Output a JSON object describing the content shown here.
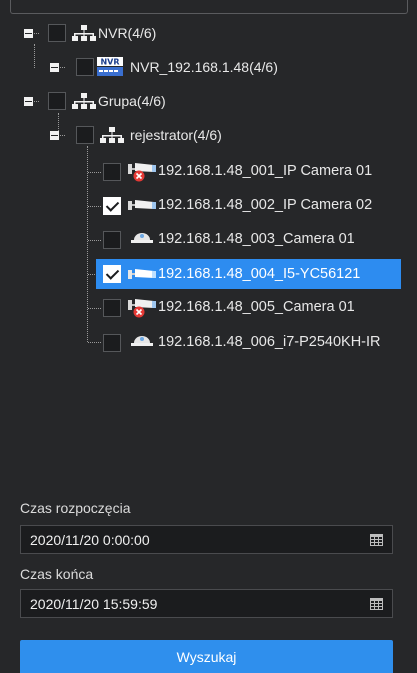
{
  "tree": {
    "nvr_group": "NVR(4/6)",
    "nvr_device": "NVR_192.168.1.48(4/6)",
    "nvr_badge": "NVR",
    "grupa": "Grupa(4/6)",
    "rejestrator": "rejestrator(4/6)",
    "cameras": [
      {
        "label": "192.168.1.48_001_IP Camera 01",
        "checked": false,
        "offline": true
      },
      {
        "label": "192.168.1.48_002_IP Camera 02",
        "checked": true,
        "offline": false
      },
      {
        "label": "192.168.1.48_003_Camera 01",
        "checked": false,
        "offline": false
      },
      {
        "label": "192.168.1.48_004_I5-YC56121",
        "checked": true,
        "offline": false
      },
      {
        "label": "192.168.1.48_005_Camera 01",
        "checked": false,
        "offline": true
      },
      {
        "label": "192.168.1.48_006_i7-P2540KH-IR",
        "checked": false,
        "offline": false
      }
    ]
  },
  "form": {
    "start_label": "Czas rozpoczęcia",
    "start_value": "2020/11/20 0:00:00",
    "end_label": "Czas końca",
    "end_value": "2020/11/20 15:59:59",
    "search_label": "Wyszukaj"
  },
  "colors": {
    "background": "#262729",
    "selection": "#2d8cf0",
    "button": "#2f8fed",
    "offline_badge": "#e53935"
  }
}
